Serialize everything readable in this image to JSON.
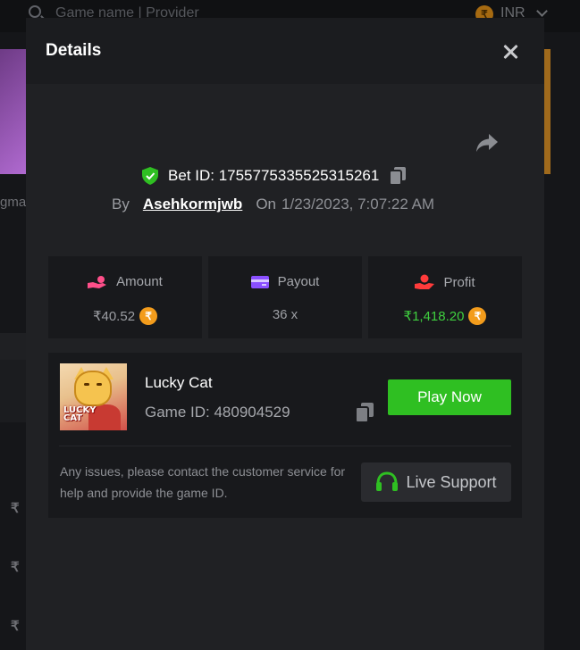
{
  "background": {
    "search_placeholder": "Game name | Provider",
    "currency": "INR",
    "currency_symbol": "₹",
    "left_text_fragment": "gma"
  },
  "modal": {
    "title": "Details",
    "bet": {
      "label": "Bet ID: ",
      "id": "1755775335525315261",
      "by_label": "By",
      "user": "Asehkormjwb",
      "on_label": "On",
      "datetime": "1/23/2023, 7:07:22 AM"
    },
    "stats": [
      {
        "label": "Amount",
        "value": "₹40.52",
        "icon": "hand-coin-icon",
        "coin": "₹"
      },
      {
        "label": "Payout",
        "value": "36 x",
        "icon": "card-icon"
      },
      {
        "label": "Profit",
        "value": "₹1,418.20",
        "icon": "profit-hand-icon",
        "coin": "₹"
      }
    ],
    "game": {
      "name": "Lucky Cat",
      "id_label": "Game ID: ",
      "id": "480904529",
      "thumb_line1": "LUCKY",
      "thumb_line2": "CAT",
      "play_label": "Play Now"
    },
    "support": {
      "text": "Any issues, please contact the customer service for help and provide the game ID.",
      "button_label": "Live Support"
    }
  },
  "colors": {
    "accent_green": "#2fbf22",
    "profit_green": "#3fcf3f",
    "coin_orange": "#f39c1c"
  }
}
